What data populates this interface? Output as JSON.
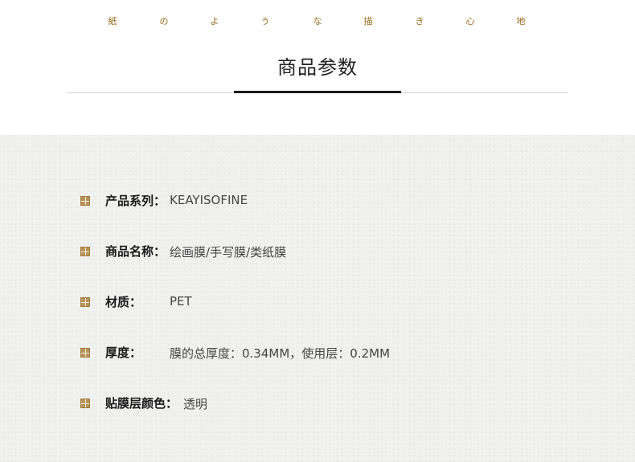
{
  "tagline": [
    "紙",
    "の",
    "よ",
    "う",
    "な",
    "描",
    "き",
    "心",
    "地"
  ],
  "section_title": "商品参数",
  "specs": [
    {
      "label": "产品系列：",
      "value": "KEAYISOFINE"
    },
    {
      "label": "商品名称：",
      "value": "绘画膜/手写膜/类纸膜"
    },
    {
      "label": "材质：",
      "value": "PET"
    },
    {
      "label": "厚度：",
      "value": "膜的总厚度：0.34MM，使用层：0.2MM"
    },
    {
      "label": "贴膜层颜色：",
      "value": "透明"
    }
  ],
  "colors": {
    "accent": "#9a6a1e",
    "icon": "#b89456",
    "panel_bg": "#efefee"
  },
  "icons": {
    "bullet": "plus-square-icon"
  }
}
